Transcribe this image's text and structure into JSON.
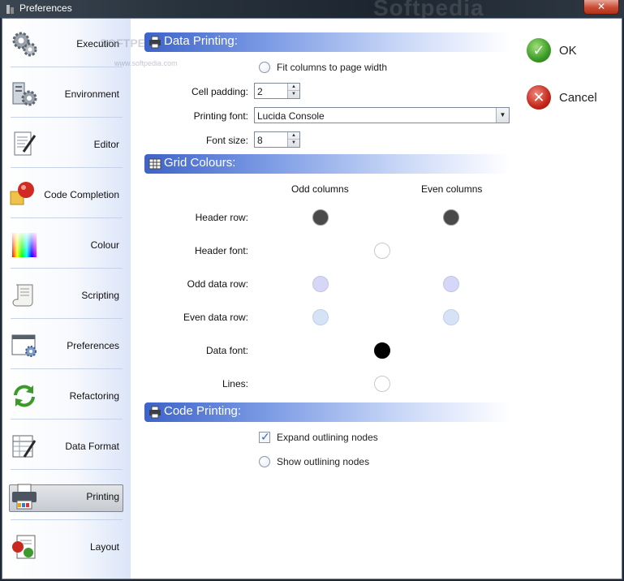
{
  "window": {
    "title": "Preferences",
    "close_label": "✕"
  },
  "watermark": {
    "top": "Softpedia",
    "side": "SOFTPEDIA",
    "url": "www.softpedia.com"
  },
  "sidebar": {
    "items": [
      {
        "label": "Execution",
        "icon": "gears-icon"
      },
      {
        "label": "Environment",
        "icon": "environment-icon"
      },
      {
        "label": "Editor",
        "icon": "editor-icon"
      },
      {
        "label": "Code Completion",
        "icon": "code-completion-icon"
      },
      {
        "label": "Colour",
        "icon": "colour-icon"
      },
      {
        "label": "Scripting",
        "icon": "scroll-icon"
      },
      {
        "label": "Preferences",
        "icon": "preferences-window-icon"
      },
      {
        "label": "Refactoring",
        "icon": "refresh-arrows-icon"
      },
      {
        "label": "Data Format",
        "icon": "data-format-icon"
      },
      {
        "label": "Printing",
        "icon": "printer-icon",
        "selected": true
      },
      {
        "label": "Layout",
        "icon": "layout-icon"
      }
    ]
  },
  "data_printing": {
    "title": "Data Printing:",
    "fit_columns_label": "Fit columns to page width",
    "fit_columns_checked": false,
    "cell_padding_label": "Cell padding:",
    "cell_padding_value": "2",
    "printing_font_label": "Printing font:",
    "printing_font_value": "Lucida Console",
    "font_size_label": "Font size:",
    "font_size_value": "8"
  },
  "grid_colours": {
    "title": "Grid Colours:",
    "odd_columns_label": "Odd columns",
    "even_columns_label": "Even columns",
    "rows": [
      {
        "label": "Header row:",
        "odd": "#4a4a4a",
        "even": "#4a4a4a"
      },
      {
        "label": "Header font:",
        "single": "#ffffff"
      },
      {
        "label": "Odd data row:",
        "odd": "#d6d7f7",
        "even": "#d6d7f7"
      },
      {
        "label": "Even data row:",
        "odd": "#d6e3f7",
        "even": "#d6e3f7"
      },
      {
        "label": "Data font:",
        "single": "#000000"
      },
      {
        "label": "Lines:",
        "single": "#ffffff"
      }
    ]
  },
  "code_printing": {
    "title": "Code Printing:",
    "expand_label": "Expand outlining nodes",
    "expand_checked": true,
    "show_label": "Show outlining nodes",
    "show_checked": false
  },
  "actions": {
    "ok_label": "OK",
    "cancel_label": "Cancel"
  },
  "colors": {
    "section_bar": "#3d63c9",
    "ok_green": "#3a9b25",
    "cancel_red": "#c3271a"
  }
}
